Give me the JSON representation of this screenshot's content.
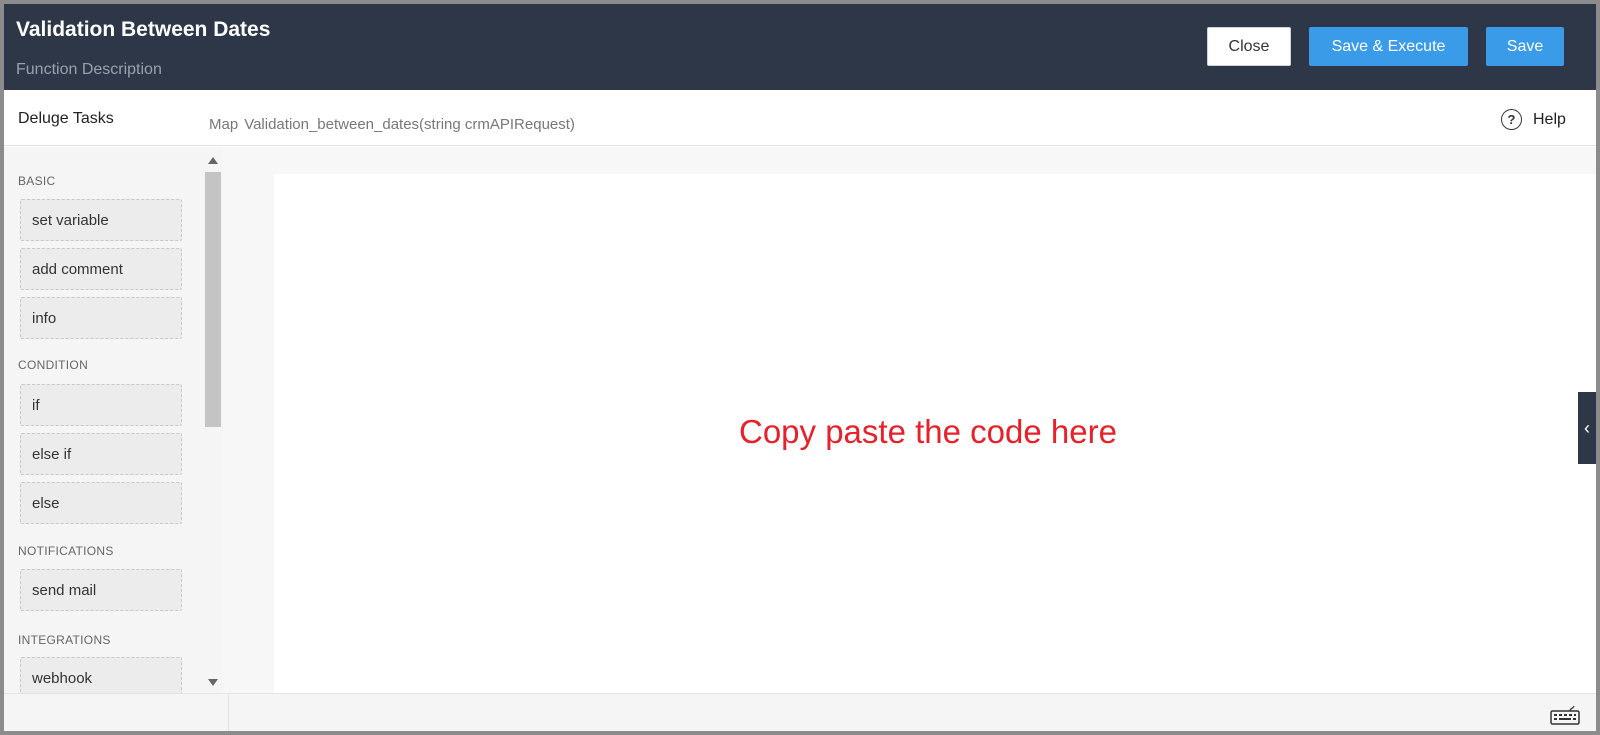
{
  "header": {
    "title": "Validation Between Dates",
    "subtitle": "Function Description",
    "buttons": {
      "close": "Close",
      "save_execute": "Save & Execute",
      "save": "Save"
    }
  },
  "subbar": {
    "deluge_title": "Deluge Tasks",
    "signature_keyword": "Map",
    "signature": "Validation_between_dates(string crmAPIRequest)",
    "help": "Help"
  },
  "sidebar": {
    "sections": [
      {
        "label": "BASIC",
        "items": [
          "set variable",
          "add comment",
          "info"
        ]
      },
      {
        "label": "CONDITION",
        "items": [
          "if",
          "else if",
          "else"
        ]
      },
      {
        "label": "NOTIFICATIONS",
        "items": [
          "send mail"
        ]
      },
      {
        "label": "INTEGRATIONS",
        "items": [
          "webhook"
        ]
      }
    ]
  },
  "editor": {
    "note": "Copy paste the code here"
  },
  "icons": {
    "help": "help-circle-icon",
    "collapse": "chevron-left-icon",
    "keyboard": "keyboard-icon"
  },
  "colors": {
    "header_bg": "#2e3748",
    "primary": "#3a9be8",
    "note": "#e8202a"
  }
}
